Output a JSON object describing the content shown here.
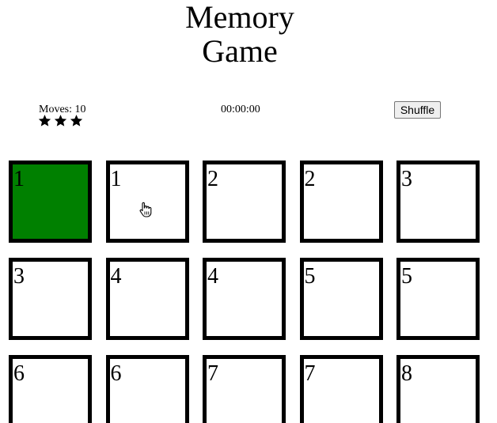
{
  "title": {
    "line1": "Memory",
    "line2": "Game"
  },
  "score_panel": {
    "moves_label": "Moves: 10",
    "stars": 3,
    "timer": "00:00:00",
    "shuffle_label": "Shuffle"
  },
  "colors": {
    "matched": "#008000",
    "card_border": "#000000",
    "card_face": "#ffffff"
  },
  "cards": [
    {
      "label": "1",
      "state": "matched"
    },
    {
      "label": "1",
      "state": "open"
    },
    {
      "label": "2",
      "state": "open"
    },
    {
      "label": "2",
      "state": "open"
    },
    {
      "label": "3",
      "state": "open"
    },
    {
      "label": "3",
      "state": "open"
    },
    {
      "label": "4",
      "state": "open"
    },
    {
      "label": "4",
      "state": "open"
    },
    {
      "label": "5",
      "state": "open"
    },
    {
      "label": "5",
      "state": "open"
    },
    {
      "label": "6",
      "state": "open"
    },
    {
      "label": "6",
      "state": "open"
    },
    {
      "label": "7",
      "state": "open"
    },
    {
      "label": "7",
      "state": "open"
    },
    {
      "label": "8",
      "state": "open"
    }
  ],
  "icons": {
    "star": "star-icon",
    "cursor": "hand-cursor-icon"
  }
}
